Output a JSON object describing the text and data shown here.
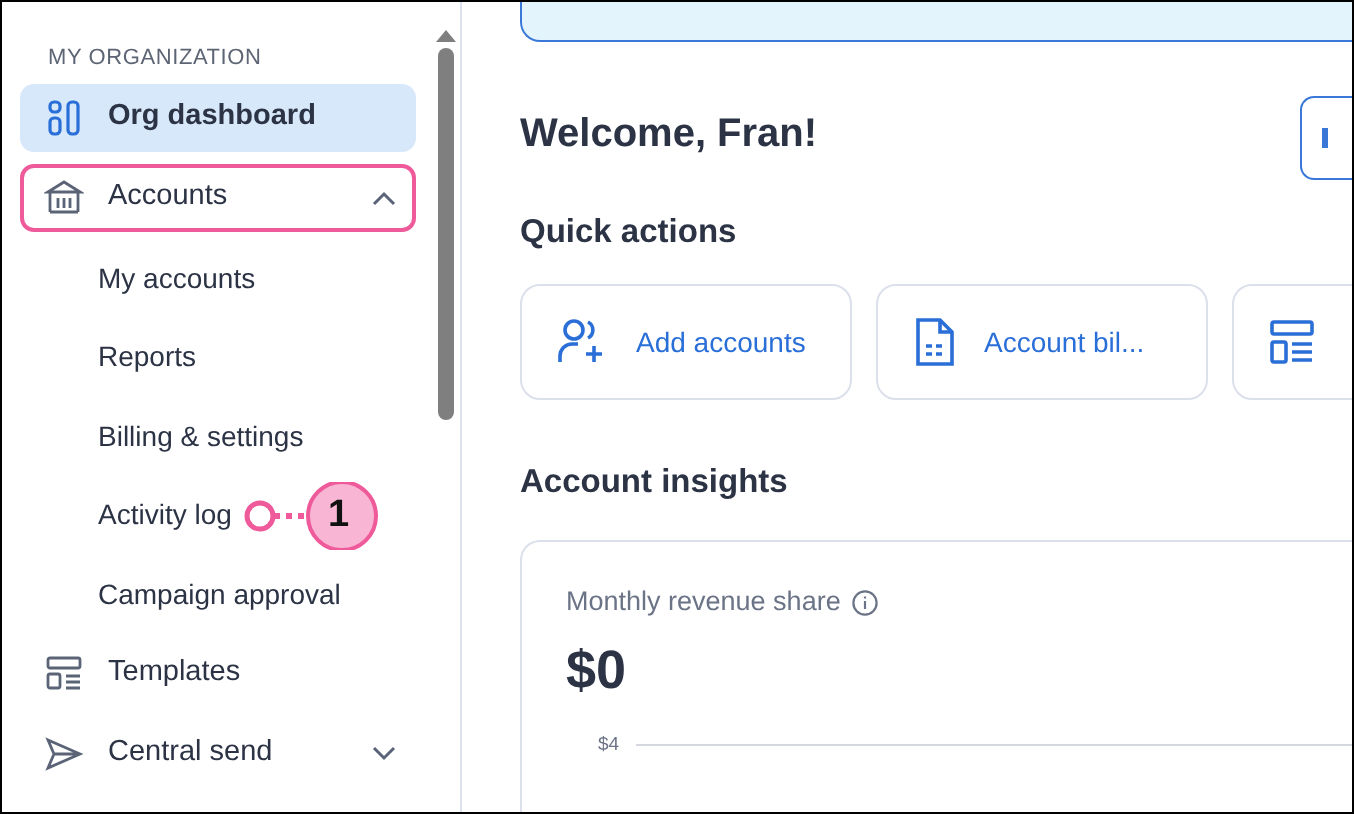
{
  "sidebar": {
    "heading": "MY ORGANIZATION",
    "items": [
      {
        "label": "Org dashboard",
        "kind": "top",
        "selected": true,
        "highlighted": false
      },
      {
        "label": "Accounts",
        "kind": "top",
        "selected": false,
        "highlighted": true,
        "expanded": true,
        "children": [
          {
            "label": "My accounts"
          },
          {
            "label": "Reports"
          },
          {
            "label": "Billing & settings"
          },
          {
            "label": "Activity log",
            "callout": "1"
          },
          {
            "label": "Campaign approval"
          }
        ]
      },
      {
        "label": "Templates",
        "kind": "top",
        "selected": false,
        "highlighted": false
      },
      {
        "label": "Central send",
        "kind": "top",
        "selected": false,
        "highlighted": false,
        "expanded": false
      }
    ]
  },
  "main": {
    "greeting": "Welcome, Fran!",
    "quick_actions": {
      "title": "Quick actions",
      "items": [
        {
          "kind": "labeled",
          "label": "Add accounts"
        },
        {
          "kind": "labeled",
          "label": "Account bil..."
        },
        {
          "kind": "icon"
        }
      ]
    },
    "insights": {
      "title": "Account insights",
      "card": {
        "title": "Monthly revenue share",
        "value": "$0",
        "ytick": "$4"
      }
    }
  }
}
